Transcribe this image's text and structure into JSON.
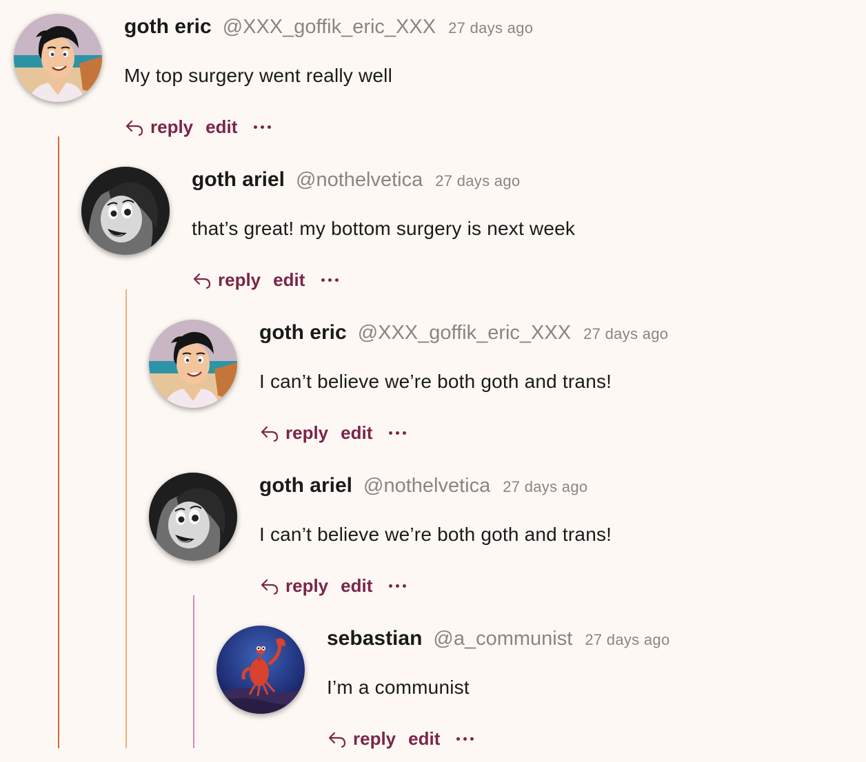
{
  "comments": [
    {
      "name": "goth eric",
      "handle": "@XXX_goffik_eric_XXX",
      "time": "27 days ago",
      "text": "My top surgery went really well",
      "reply_label": "reply",
      "edit_label": "edit",
      "avatar_icon": "eric-avatar"
    },
    {
      "name": "goth ariel",
      "handle": "@nothelvetica",
      "time": "27 days ago",
      "text": "that’s great! my bottom surgery is next week",
      "reply_label": "reply",
      "edit_label": "edit",
      "avatar_icon": "ariel-avatar"
    },
    {
      "name": "goth eric",
      "handle": "@XXX_goffik_eric_XXX",
      "time": "27 days ago",
      "text": "I can’t believe we’re both goth and trans!",
      "reply_label": "reply",
      "edit_label": "edit",
      "avatar_icon": "eric-avatar"
    },
    {
      "name": "goth ariel",
      "handle": "@nothelvetica",
      "time": "27 days ago",
      "text": "I can’t believe we’re both goth and trans!",
      "reply_label": "reply",
      "edit_label": "edit",
      "avatar_icon": "ariel-avatar"
    },
    {
      "name": "sebastian",
      "handle": "@a_communist",
      "time": "27 days ago",
      "text": "I’m a communist",
      "reply_label": "reply",
      "edit_label": "edit",
      "avatar_icon": "sebastian-avatar"
    }
  ],
  "colors": {
    "background": "#fdf8f3",
    "action": "#7a2548",
    "muted": "#8a8580",
    "thread_level_1": "#d9663f",
    "thread_level_2": "#f0b07a",
    "thread_level_3": "#d48ab8"
  },
  "icons": {
    "reply": "reply-arrow-icon",
    "more": "more-dots-icon"
  }
}
